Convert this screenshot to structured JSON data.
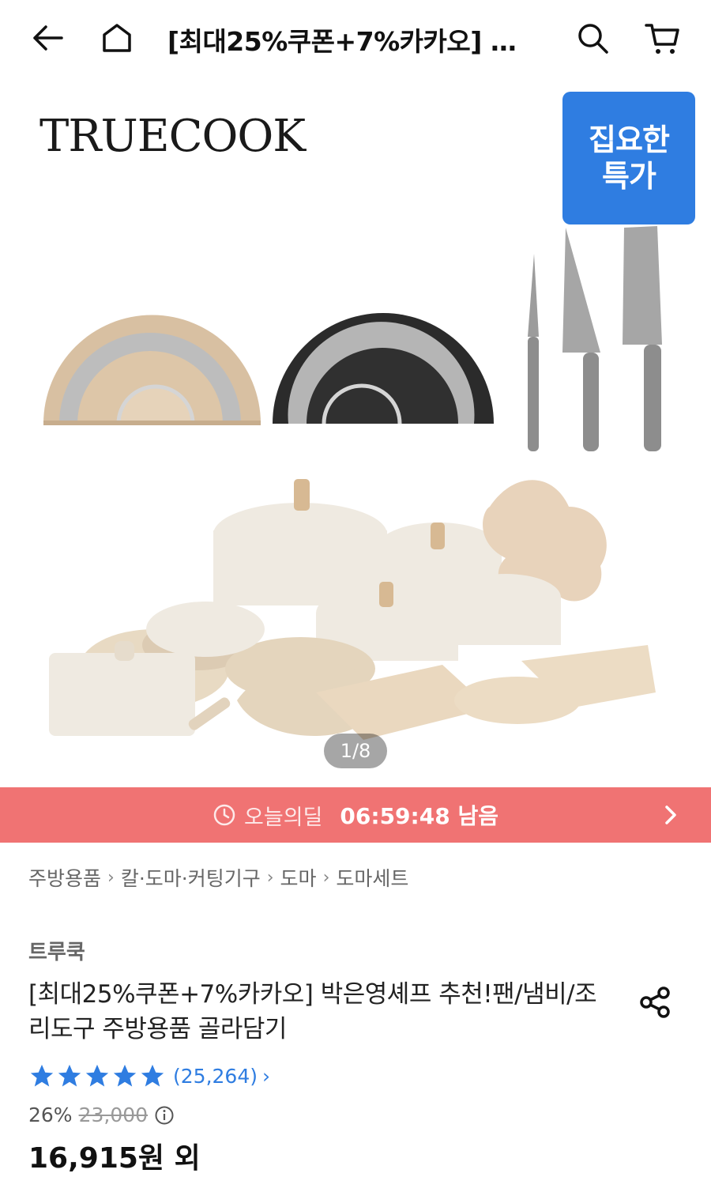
{
  "topbar": {
    "title": "[최대25%쿠폰+7%카카오] …",
    "icons": [
      "back-arrow-icon",
      "home-icon",
      "search-icon",
      "cart-icon"
    ]
  },
  "hero": {
    "brand_logo": "TRUECOOK",
    "promo_badge_line1": "집요한",
    "promo_badge_line2": "특가",
    "slide_counter": "1/8"
  },
  "deal": {
    "label": "오늘의딜",
    "time_remaining": "06:59:48 남음",
    "color": "#f07373"
  },
  "breadcrumb": [
    "주방용품",
    "칼·도마·커팅기구",
    "도마",
    "도마세트"
  ],
  "product": {
    "brand": "트루쿡",
    "title": "[최대25%쿠폰+7%카카오] 박은영셰프 추천!팬/냄비/조리도구 주방용품 골라담기",
    "rating_stars": 5,
    "review_count": "(25,264)",
    "discount": "26%",
    "original_price": "23,000",
    "final_price": "16,915원 외"
  },
  "colors": {
    "accent": "#2f7de1",
    "deal_banner": "#f07373"
  }
}
